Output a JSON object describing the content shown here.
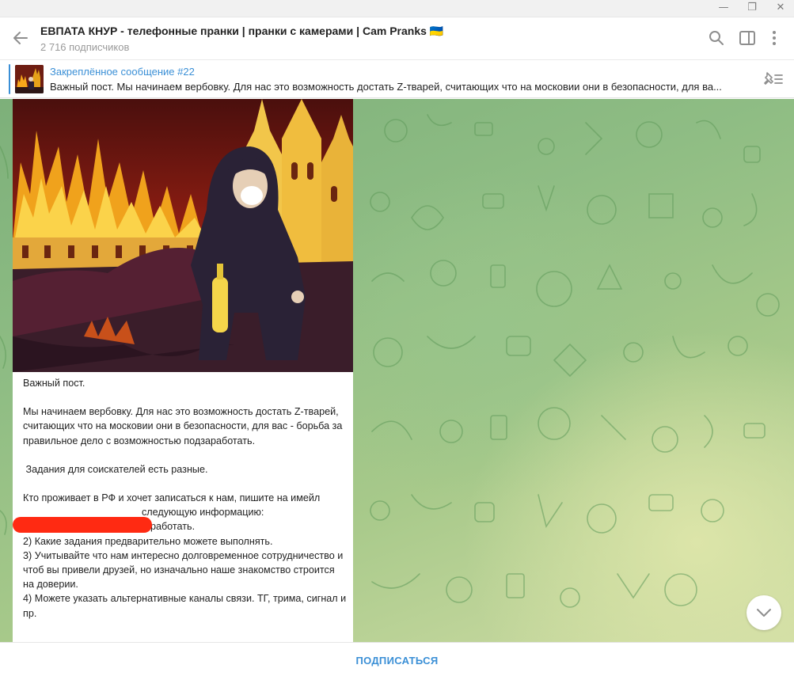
{
  "window": {
    "minimize_glyph": "—",
    "restore_glyph": "❐",
    "close_glyph": "✕"
  },
  "header": {
    "title": "ЕВПАТА КНУР - телефонные пранки | пранки с камерами | Cam Pranks 🇺🇦",
    "subscribers": "2 716 подписчиков",
    "icons": [
      "back-arrow-icon",
      "search-icon",
      "sidebar-toggle-icon",
      "more-vertical-icon"
    ]
  },
  "pinned": {
    "title": "Закреплённое сообщение #22",
    "text": "Важный пост.  Мы начинаем вербовку. Для нас это возможность достать Z-тварей, считающих что на московии они в безопасности, для ва...",
    "icon": "unpin-list-icon"
  },
  "message": {
    "paragraphs": [
      "Важный пост.",
      "Мы начинаем вербовку. Для нас это возможность достать Z-тварей, считающих что на московии они в безопасности, для вас - борьба за правильное дело с возможностью подзаработать.",
      " Задания для соискателей есть разные.",
      "Кто проживает в РФ и хочет записаться к нам, пишите на имейл"
    ],
    "list_intro": "следующую информацию:",
    "list": [
      "1) В каком регионе можете работать.",
      "2) Какие задания предварительно можете выполнять.",
      "3) Учитывайте что нам интересно долговременное сотрудничество и чтоб вы привели друзей, но изначально наше знакомство строится на доверии.",
      "4) Можете указать альтернативные каналы связи. ТГ, трима, сигнал и пр."
    ],
    "image_icon": "burning-kremlin-illustration"
  },
  "scroll_button": {
    "icon": "chevron-down-icon"
  },
  "bottom": {
    "subscribe_label": "ПОДПИСАТЬСЯ"
  },
  "colors": {
    "accent": "#3a8fd6",
    "chat_bg": "#8fbd84",
    "redaction": "#ff2a12"
  }
}
